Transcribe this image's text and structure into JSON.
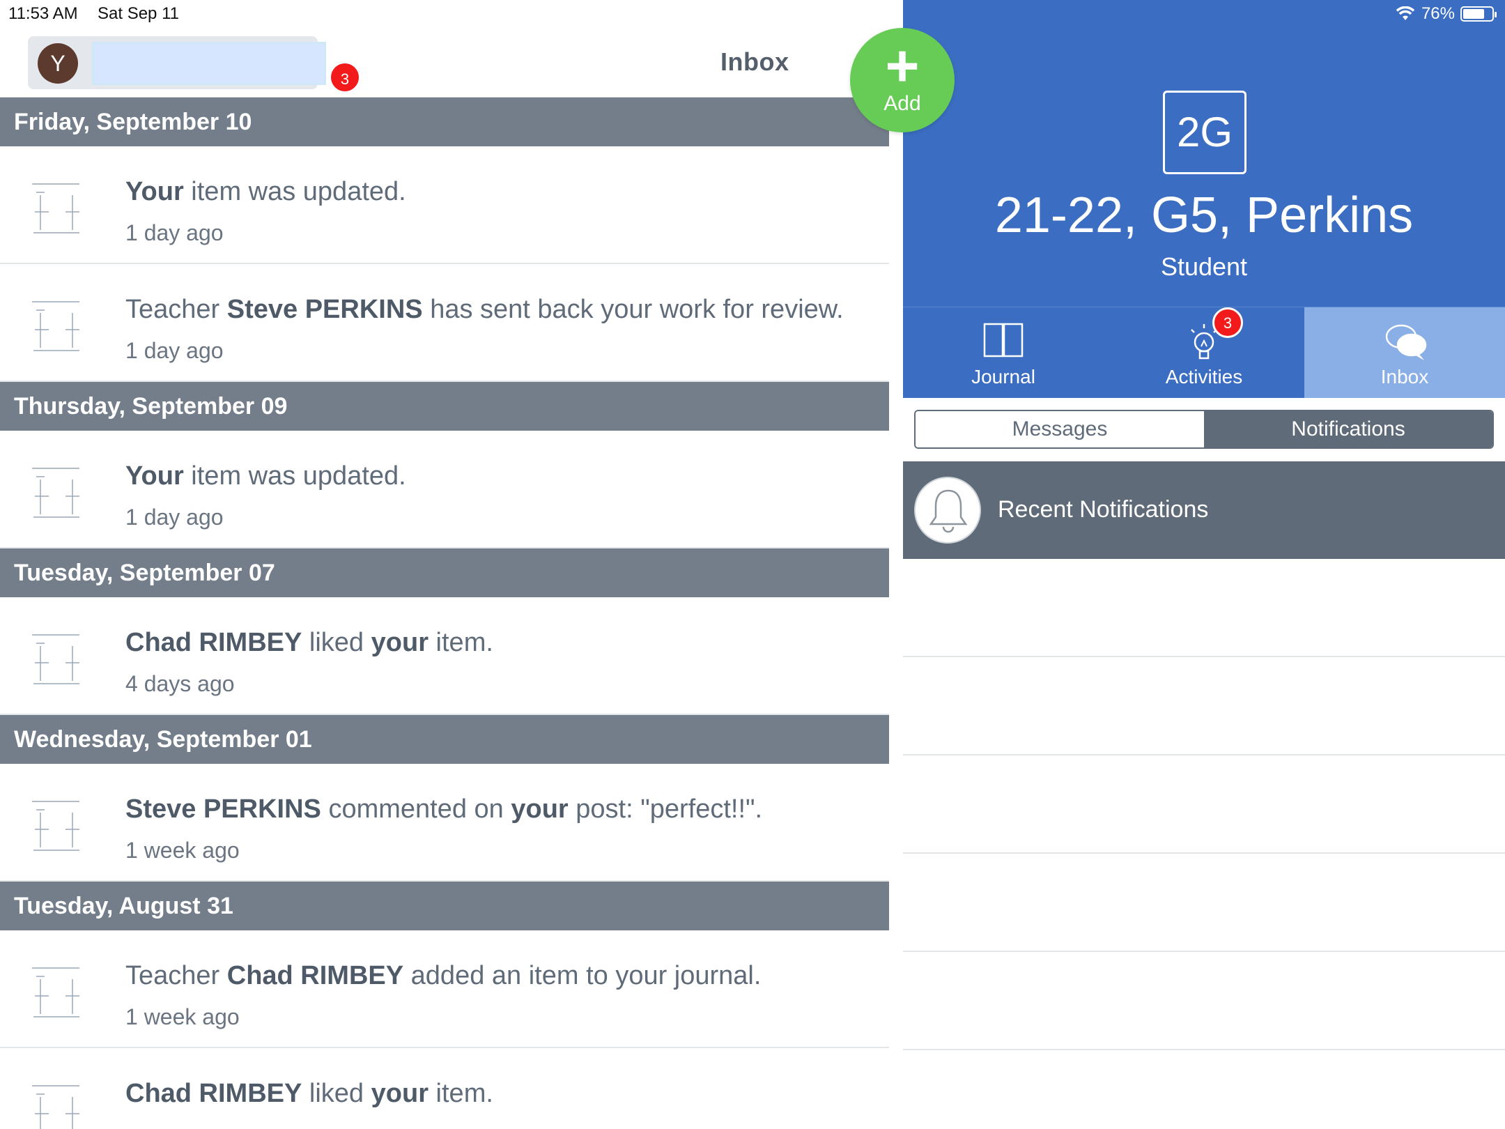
{
  "status_bar": {
    "time": "11:53 AM",
    "date": "Sat Sep 11",
    "battery": "76%",
    "battery_level": 0.76
  },
  "header": {
    "avatar_initial": "Y",
    "badge_count": "3",
    "title": "Inbox"
  },
  "add_button": {
    "label": "Add",
    "color": "#66cc55"
  },
  "feed": {
    "sections": [
      {
        "date": "Friday, September 10",
        "items": [
          {
            "actor": "",
            "bold1": "Your",
            "text1": " item was updated.",
            "bold2": "",
            "text2": "",
            "ago": "1 day ago"
          },
          {
            "actor": "",
            "bold1": "",
            "text1": "Teacher ",
            "bold2": "Steve PERKINS",
            "text2": " has sent back your work for review.",
            "ago": "1 day ago"
          }
        ]
      },
      {
        "date": "Thursday, September 09",
        "items": [
          {
            "bold1": "Your",
            "text1": " item was updated.",
            "bold2": "",
            "text2": "",
            "ago": "1 day ago"
          }
        ]
      },
      {
        "date": "Tuesday, September 07",
        "items": [
          {
            "bold1": "Chad RIMBEY",
            "text1": " liked ",
            "bold2": "your",
            "text2": " item.",
            "ago": "4 days ago"
          }
        ]
      },
      {
        "date": "Wednesday, September 01",
        "items": [
          {
            "bold1": "Steve PERKINS",
            "text1": " commented on ",
            "bold2": "your",
            "text2": " post: \"perfect!!\".",
            "ago": "1 week ago"
          }
        ]
      },
      {
        "date": "Tuesday, August 31",
        "items": [
          {
            "bold1": "",
            "text1": "Teacher ",
            "bold2": "Chad RIMBEY",
            "text2": " added an item to your journal.",
            "ago": "1 week ago"
          },
          {
            "bold1": "Chad RIMBEY",
            "text1": " liked ",
            "bold2": "your",
            "text2": " item.",
            "ago": ""
          }
        ]
      }
    ]
  },
  "class": {
    "code": "2G",
    "name": "21-22, G5, Perkins",
    "role": "Student",
    "color": "#3b6dc2"
  },
  "tabs": [
    {
      "label": "Journal",
      "icon": "book-icon"
    },
    {
      "label": "Activities",
      "icon": "lightbulb-icon",
      "badge": "3"
    },
    {
      "label": "Inbox",
      "icon": "chat-bubbles-icon",
      "active": true
    }
  ],
  "segments": {
    "messages": "Messages",
    "notifications": "Notifications",
    "active": "notifications"
  },
  "recent": {
    "label": "Recent Notifications",
    "icon": "bell-icon"
  }
}
